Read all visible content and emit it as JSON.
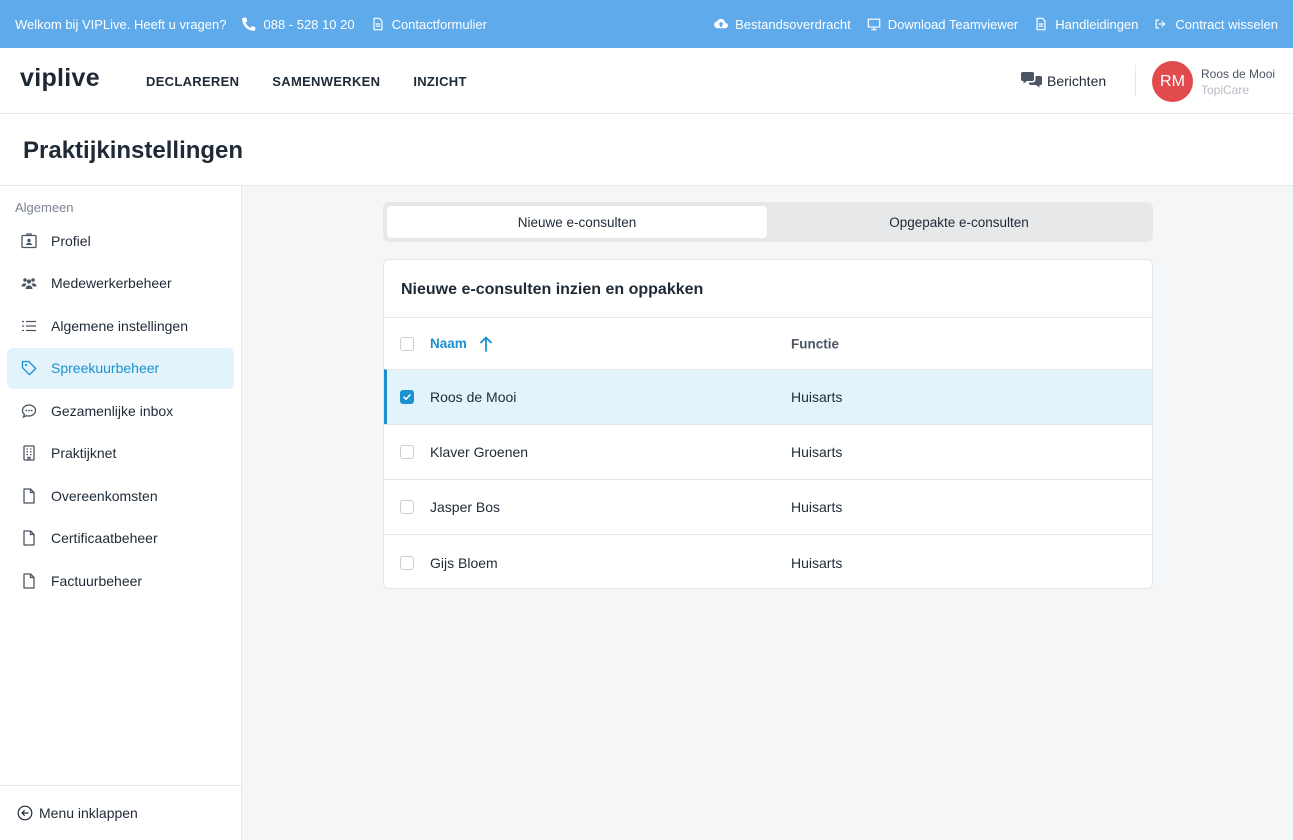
{
  "infobar": {
    "welcome": "Welkom bij VIPLive. Heeft u vragen?",
    "phone": "088 - 528 10 20",
    "contact": "Contactformulier",
    "links": [
      "Bestandsoverdracht",
      "Download Teamviewer",
      "Handleidingen",
      "Contract wisselen"
    ],
    "background_color": "#5eaaea"
  },
  "nav": {
    "logo": "viplive",
    "links": [
      "DECLAREREN",
      "SAMENWERKEN",
      "INZICHT"
    ],
    "messages": "Berichten",
    "avatar_initials": "RM",
    "user_name": "Roos de Mooi",
    "user_org": "TopiCare",
    "avatar_color": "#e14b4e"
  },
  "page": {
    "title": "Praktijkinstellingen"
  },
  "sidebar": {
    "section": "Algemeen",
    "items": [
      {
        "label": "Profiel",
        "icon": "id-card-icon",
        "active": false
      },
      {
        "label": "Medewerkerbeheer",
        "icon": "users-icon",
        "active": false
      },
      {
        "label": "Algemene instellingen",
        "icon": "list-icon",
        "active": false
      },
      {
        "label": "Spreekuurbeheer",
        "icon": "tag-icon",
        "active": true
      },
      {
        "label": "Gezamenlijke inbox",
        "icon": "chat-icon",
        "active": false
      },
      {
        "label": "Praktijknet",
        "icon": "building-icon",
        "active": false
      },
      {
        "label": "Overeenkomsten",
        "icon": "file-icon",
        "active": false
      },
      {
        "label": "Certificaatbeheer",
        "icon": "file-icon",
        "active": false
      },
      {
        "label": "Factuurbeheer",
        "icon": "file-icon",
        "active": false
      }
    ],
    "collapse": "Menu inklappen",
    "accent_color": "#1b91cf"
  },
  "tabs": {
    "active": "Nieuwe e-consulten",
    "inactive": "Opgepakte e-consulten"
  },
  "card": {
    "title": "Nieuwe e-consulten inzien en oppakken",
    "columns": {
      "name": "Naam",
      "function": "Functie"
    },
    "rows": [
      {
        "name": "Roos de Mooi",
        "function": "Huisarts",
        "checked": true
      },
      {
        "name": "Klaver Groenen",
        "function": "Huisarts",
        "checked": false
      },
      {
        "name": "Jasper Bos",
        "function": "Huisarts",
        "checked": false
      },
      {
        "name": "Gijs Bloem",
        "function": "Huisarts",
        "checked": false
      }
    ]
  }
}
